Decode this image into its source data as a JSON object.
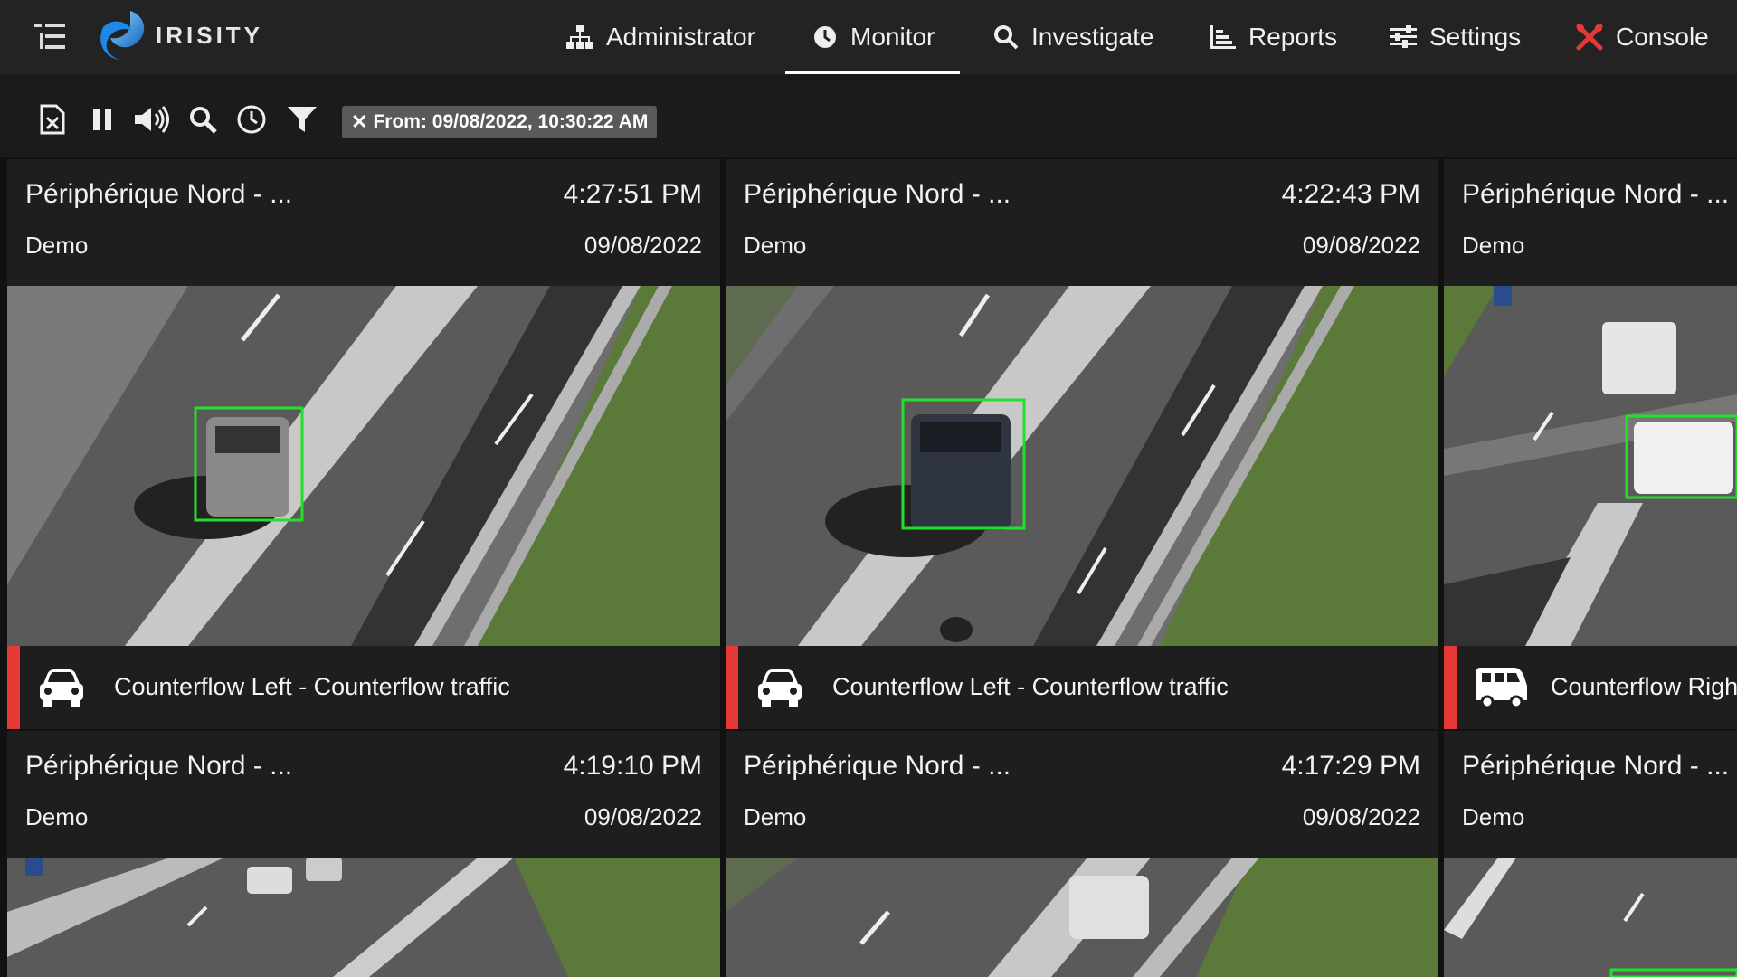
{
  "app": {
    "brand": "IRISITY"
  },
  "nav": {
    "items": [
      {
        "label": "Administrator",
        "icon": "org-chart-icon"
      },
      {
        "label": "Monitor",
        "icon": "clock-icon",
        "active": true
      },
      {
        "label": "Investigate",
        "icon": "search-icon"
      },
      {
        "label": "Reports",
        "icon": "bar-chart-icon"
      },
      {
        "label": "Settings",
        "icon": "sliders-icon"
      },
      {
        "label": "Console",
        "icon": "tools-icon"
      }
    ]
  },
  "toolbar": {
    "filter_chip": "From: 09/08/2022, 10:30:22 AM",
    "chip_close": "✕"
  },
  "colors": {
    "alert": "#e53935",
    "detection_box": "#22e02a",
    "accent_console": "#e53935"
  },
  "cards": [
    {
      "camera": "Périphérique Nord - ...",
      "time": "4:27:51 PM",
      "site": "Demo",
      "date": "09/08/2022",
      "event": "Counterflow Left - Counterflow traffic",
      "vehicle_icon": "car-icon"
    },
    {
      "camera": "Périphérique Nord - ...",
      "time": "4:22:43 PM",
      "site": "Demo",
      "date": "09/08/2022",
      "event": "Counterflow Left - Counterflow traffic",
      "vehicle_icon": "car-icon"
    },
    {
      "camera": "Périphérique Nord - ...",
      "time": "",
      "site": "Demo",
      "date": "",
      "event": "Counterflow Righ",
      "vehicle_icon": "van-icon"
    },
    {
      "camera": "Périphérique Nord - ...",
      "time": "4:19:10 PM",
      "site": "Demo",
      "date": "09/08/2022",
      "event": "",
      "vehicle_icon": ""
    },
    {
      "camera": "Périphérique Nord - ...",
      "time": "4:17:29 PM",
      "site": "Demo",
      "date": "09/08/2022",
      "event": "",
      "vehicle_icon": ""
    },
    {
      "camera": "Périphérique Nord - ...",
      "time": "",
      "site": "Demo",
      "date": "",
      "event": "",
      "vehicle_icon": ""
    }
  ]
}
